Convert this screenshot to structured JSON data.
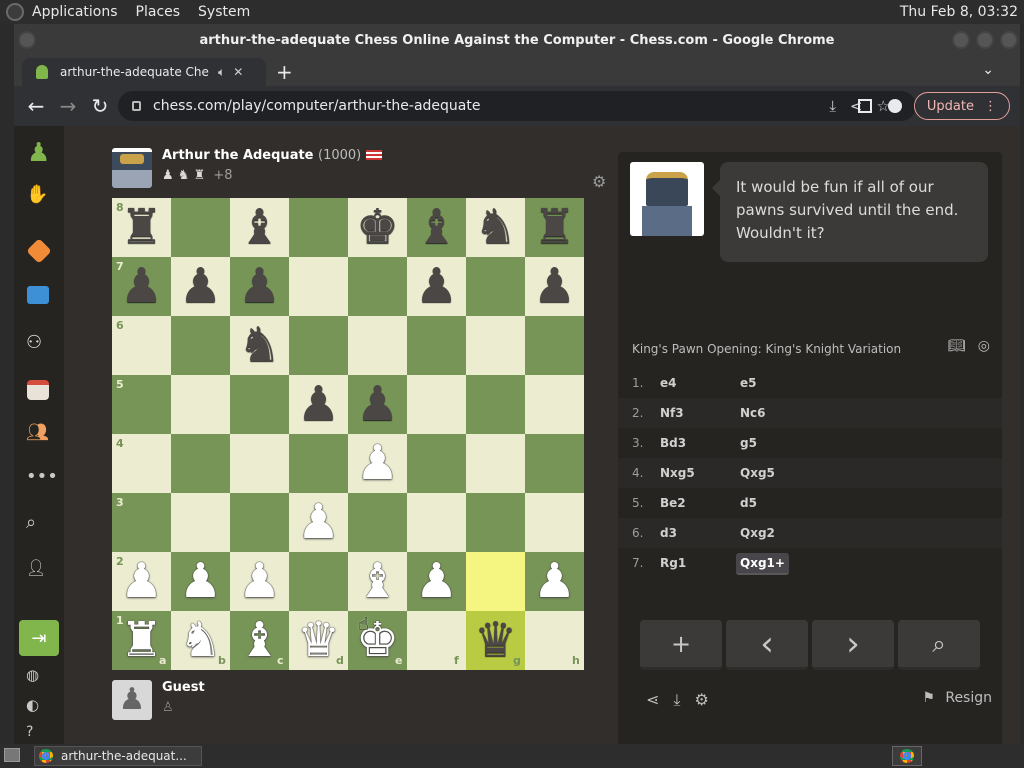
{
  "topbar": {
    "menus": [
      "Applications",
      "Places",
      "System"
    ],
    "clock": "Thu Feb 8, 03:32"
  },
  "window": {
    "title": "arthur-the-adequate Chess Online Against the Computer - Chess.com - Google Chrome"
  },
  "tab": {
    "title": "arthur-the-adequate Che",
    "new_tab": "+"
  },
  "omnibox": {
    "url": "chess.com/play/computer/arthur-the-adequate"
  },
  "toolbar": {
    "update_label": "Update"
  },
  "opponent": {
    "name": "Arthur the Adequate",
    "rating": "(1000)",
    "captured": "♟ ♞ ♜",
    "advantage": "+8"
  },
  "player": {
    "name": "Guest",
    "captured": "♙"
  },
  "board": {
    "ranks": [
      "8",
      "7",
      "6",
      "5",
      "4",
      "3",
      "2",
      "1"
    ],
    "files": [
      "a",
      "b",
      "c",
      "d",
      "e",
      "f",
      "g",
      "h"
    ],
    "light_color": "#ebecd0",
    "dark_color": "#779556",
    "highlight_light": "#f5f682",
    "highlight_dark": "#b9ca43",
    "position": [
      [
        "r",
        "",
        "b",
        "",
        "k",
        "b",
        "n",
        "r"
      ],
      [
        "p",
        "p",
        "p",
        "",
        "",
        "p",
        "",
        "p"
      ],
      [
        "",
        "",
        "n",
        "",
        "",
        "",
        "",
        ""
      ],
      [
        "",
        "",
        "",
        "p",
        "p",
        "",
        "",
        ""
      ],
      [
        "",
        "",
        "",
        "",
        "P",
        "",
        "",
        ""
      ],
      [
        "",
        "",
        "",
        "P",
        "",
        "",
        "",
        ""
      ],
      [
        "P",
        "P",
        "P",
        "",
        "B",
        "P",
        "",
        "P"
      ],
      [
        "R",
        "N",
        "B",
        "Q",
        "K",
        "",
        "q",
        ""
      ]
    ],
    "highlighted": [
      "g2",
      "g1"
    ]
  },
  "coach": {
    "message": "It would be fun if all of our pawns survived until the end. Wouldn't it?"
  },
  "opening": "King's Pawn Opening: King's Knight Variation",
  "moves": [
    {
      "num": "1.",
      "white": "e4",
      "black": "e5"
    },
    {
      "num": "2.",
      "white": "Nf3",
      "black": "Nc6"
    },
    {
      "num": "3.",
      "white": "Bd3",
      "black": "g5"
    },
    {
      "num": "4.",
      "white": "Nxg5",
      "black": "Qxg5"
    },
    {
      "num": "5.",
      "white": "Be2",
      "black": "d5"
    },
    {
      "num": "6.",
      "white": "d3",
      "black": "Qxg2"
    },
    {
      "num": "7.",
      "white": "Rg1",
      "black": "Qxg1+"
    }
  ],
  "controls": {
    "new": "+",
    "back": "‹",
    "forward": "›",
    "analyze": "⌕"
  },
  "resign_label": "Resign",
  "taskbar": {
    "item": "arthur-the-adequat..."
  },
  "sidebar_icons": [
    "pawn-logo-icon",
    "play-icon",
    "puzzles-icon",
    "learn-icon",
    "watch-icon",
    "news-icon",
    "social-icon",
    "more-icon",
    "search-icon",
    "add-friend-icon",
    "login-icon",
    "globe-icon",
    "theme-icon",
    "help-icon"
  ]
}
